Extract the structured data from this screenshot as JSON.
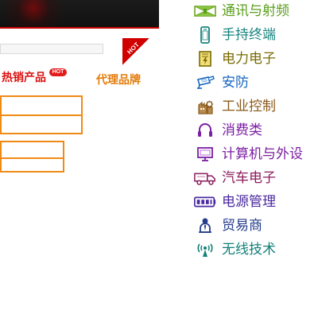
{
  "left_panel": {
    "hot_corner_label": "HOT",
    "hot_badge_label": "HOT",
    "tabs": {
      "hot_products": "热销产品",
      "agent_brands": "代理品牌"
    }
  },
  "categories": [
    {
      "label": "通讯与射频",
      "icon": "communication-rf-icon",
      "color": "#5a9e1b"
    },
    {
      "label": "手持终端",
      "icon": "handheld-terminal-icon",
      "color": "#18847f"
    },
    {
      "label": "电力电子",
      "icon": "power-electronics-icon",
      "color": "#7a6a00"
    },
    {
      "label": "安防",
      "icon": "security-camera-icon",
      "color": "#1565c0"
    },
    {
      "label": "工业控制",
      "icon": "industrial-control-icon",
      "color": "#8a5a1a"
    },
    {
      "label": "消费类",
      "icon": "headphones-icon",
      "color": "#7b1fa2"
    },
    {
      "label": "计算机与外设",
      "icon": "computer-monitor-icon",
      "color": "#7b1fa2"
    },
    {
      "label": "汽车电子",
      "icon": "truck-icon",
      "color": "#8e1b5c"
    },
    {
      "label": "电源管理",
      "icon": "battery-icon",
      "color": "#4b2aa0"
    },
    {
      "label": "贸易商",
      "icon": "trader-person-icon",
      "color": "#253c8c"
    },
    {
      "label": "无线技术",
      "icon": "wireless-signal-icon",
      "color": "#138077"
    }
  ]
}
